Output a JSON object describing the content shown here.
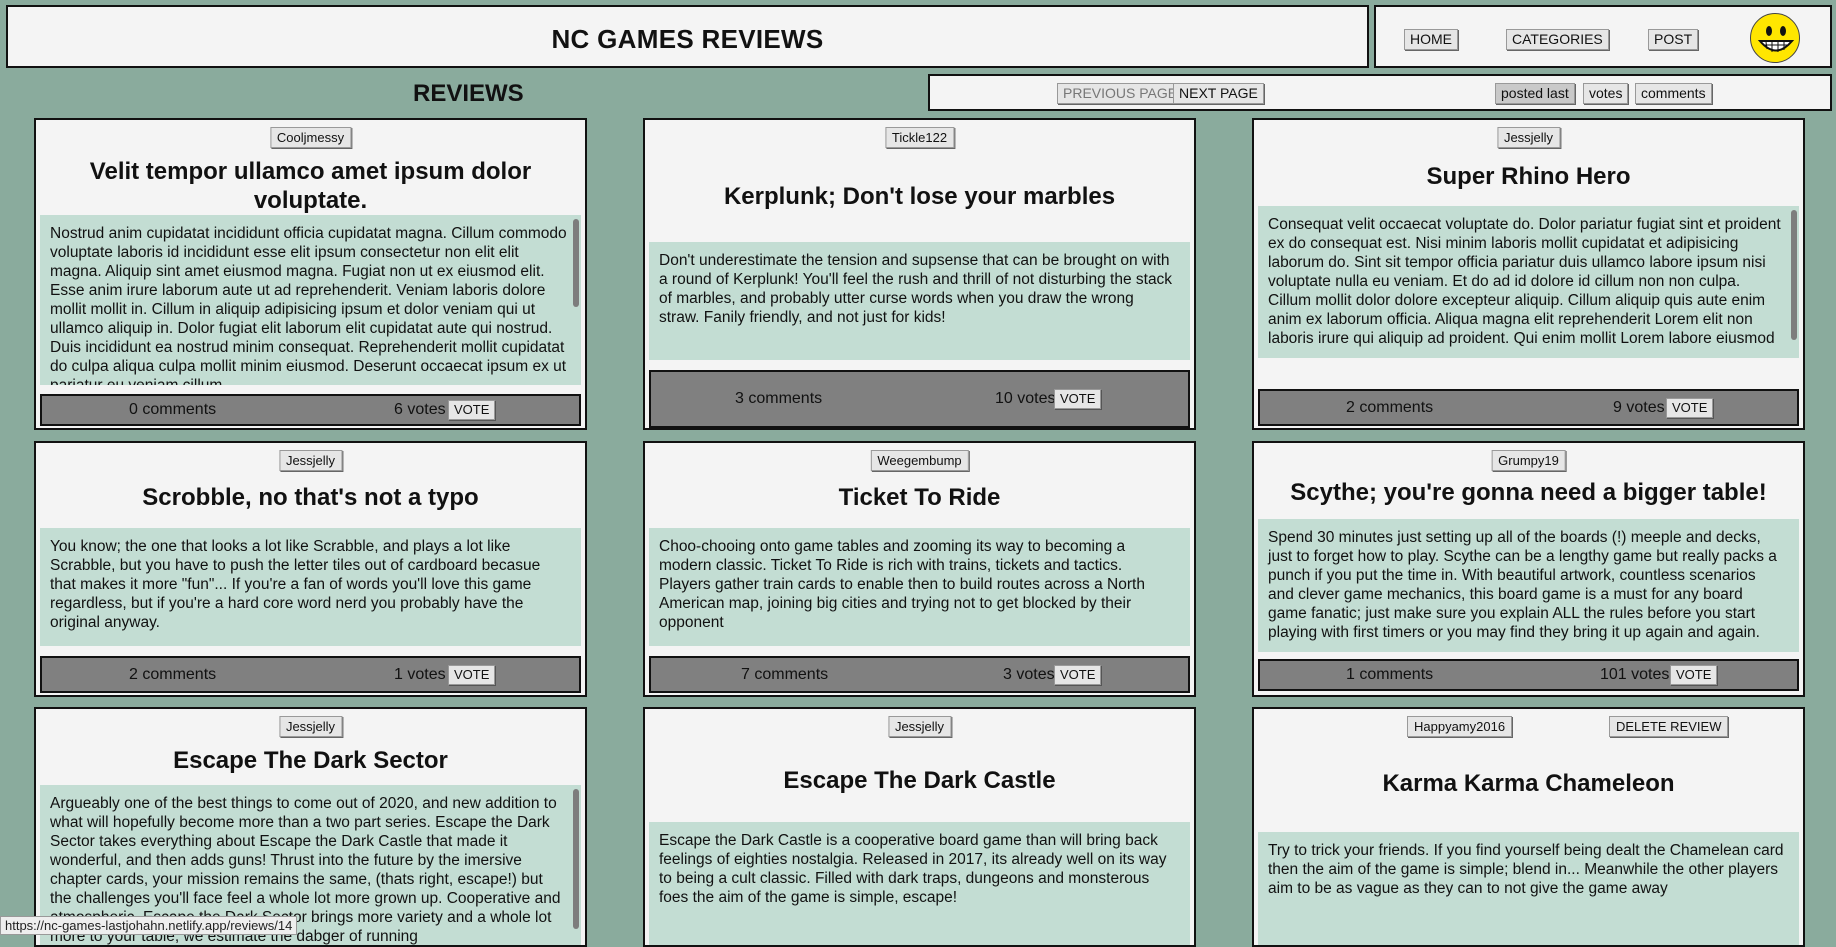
{
  "header": {
    "title": "NC GAMES REVIEWS"
  },
  "nav": {
    "home": "HOME",
    "categories": "CATEGORIES",
    "post": "POST"
  },
  "reviews_title": "REVIEWS",
  "pagination": {
    "previous": "PREVIOUS PAGE",
    "next": "NEXT PAGE"
  },
  "sort": {
    "posted": "posted last",
    "votes": "votes",
    "comments": "comments"
  },
  "vote_label": "VOTE",
  "delete_label": "DELETE REVIEW",
  "status_url": "https://nc-games-lastjohahn.netlify.app/reviews/14",
  "reviews": [
    {
      "author": "Cooljmessy",
      "title": "Velit tempor ullamco amet ipsum dolor voluptate.",
      "body": "Nostrud anim cupidatat incididunt officia cupidatat magna. Cillum commodo voluptate laboris id incididunt esse elit ipsum consectetur non elit elit magna. Aliquip sint amet eiusmod magna. Fugiat non ut ex eiusmod elit. Esse anim irure laborum aute ut ad reprehenderit. Veniam laboris dolore mollit mollit in. Cillum in aliquip adipisicing ipsum et dolor veniam qui ut ullamco aliquip in. Dolor fugiat elit laborum elit cupidatat aute qui nostrud. Duis incididunt ea nostrud minim consequat. Reprehenderit mollit cupidatat do culpa aliqua culpa mollit minim eiusmod. Deserunt occaecat ipsum ex ut pariatur eu veniam cillum.",
      "comments": "0 comments",
      "votes": "6 votes"
    },
    {
      "author": "Tickle122",
      "title": "Kerplunk; Don't lose your marbles",
      "body": "Don't underestimate the tension and supsense that can be brought on with a round of Kerplunk! You'll feel the rush and thrill of not disturbing the stack of marbles, and probably utter curse words when you draw the wrong straw. Fanily friendly, and not just for kids!",
      "comments": "3 comments",
      "votes": "10 votes"
    },
    {
      "author": "Jessjelly",
      "title": "Super Rhino Hero",
      "body": "Consequat velit occaecat voluptate do. Dolor pariatur fugiat sint et proident ex do consequat est. Nisi minim laboris mollit cupidatat et adipisicing laborum do. Sint sit tempor officia pariatur duis ullamco labore ipsum nisi voluptate nulla eu veniam. Et do ad id dolore id cillum non non culpa. Cillum mollit dolor dolore excepteur aliquip. Cillum aliquip quis aute enim anim ex laborum officia. Aliqua magna elit reprehenderit Lorem elit non laboris irure qui aliquip ad proident. Qui enim mollit Lorem labore eiusmod",
      "comments": "2 comments",
      "votes": "9 votes"
    },
    {
      "author": "Jessjelly",
      "title": "Scrobble, no that's not a typo",
      "body": "You know; the one that looks a lot like Scrabble, and plays a lot like Scrabble, but you have to push the letter tiles out of cardboard becasue that makes it more \"fun\"... If you're a fan of words you'll love this game regardless, but if you're a hard core word nerd you probably have the original anyway.",
      "comments": "2 comments",
      "votes": "1 votes"
    },
    {
      "author": "Weegembump",
      "title": "Ticket To Ride",
      "body": "Choo-chooing onto game tables and zooming its way to becoming a modern classic. Ticket To Ride is rich with trains, tickets and tactics. Players gather train cards to enable then to build routes across a North American map, joining big cities and trying not to get blocked by their opponent",
      "comments": "7 comments",
      "votes": "3 votes"
    },
    {
      "author": "Grumpy19",
      "title": "Scythe; you're gonna need a bigger table!",
      "body": "Spend 30 minutes just setting up all of the boards (!) meeple and decks, just to forget how to play. Scythe can be a lengthy game but really packs a punch if you put the time in. With beautiful artwork, countless scenarios and clever game mechanics, this board game is a must for any board game fanatic; just make sure you explain ALL the rules before you start playing with first timers or you may find they bring it up again and again.",
      "comments": "1 comments",
      "votes": "101 votes"
    },
    {
      "author": "Jessjelly",
      "title": "Escape The Dark Sector",
      "body": "Argueably one of the best things to come out of 2020, and new addition to what will hopefully become more than a two part series. Escape the Dark Sector takes everything about Escape the Dark Castle that made it wonderful, and then adds guns! Thrust into the future by the imersive chapter cards, your mission remains the same, (thats right, escape!) but the challenges you'll face feel a whole lot more grown up. Cooperative and atmospheric, Escape the Dark Sector brings more variety and a whole lot more to your table, we estimate the dabger of running",
      "comments": "",
      "votes": ""
    },
    {
      "author": "Jessjelly",
      "title": "Escape The Dark Castle",
      "body": "Escape the Dark Castle is a cooperative board game than will bring back feelings of eighties nostalgia. Released in 2017, its already well on its way to being a cult classic. Filled with dark traps, dungeons and monsterous foes the aim of the game is simple, escape!",
      "comments": "",
      "votes": ""
    },
    {
      "author": "Happyamy2016",
      "title": "Karma Karma Chameleon",
      "body": "Try to trick your friends. If you find yourself being dealt the Chamelean card then the aim of the game is simple; blend in... Meanwhile the other players aim to be as vague as they can to not give the game away",
      "comments": "",
      "votes": ""
    }
  ]
}
